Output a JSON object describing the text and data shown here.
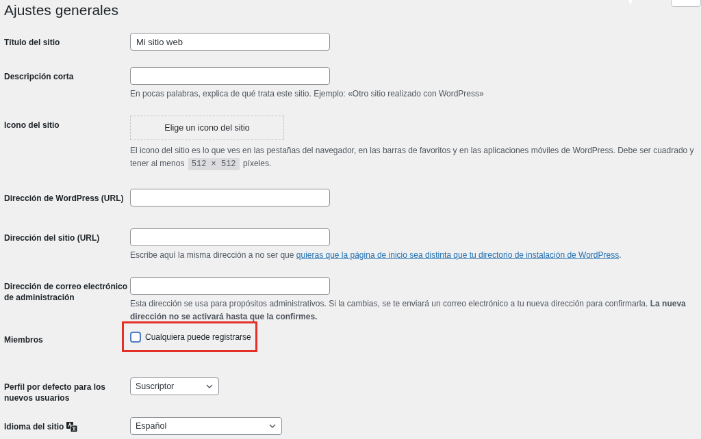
{
  "page_title": "Ajustes generales",
  "rows": [
    {
      "kind": "text",
      "label": "Título del sitio",
      "value": "Mi sitio web"
    },
    {
      "kind": "text",
      "label": "Descripción corta",
      "value": "",
      "description": "En pocas palabras, explica de qué trata este sitio. Ejemplo: «Otro sitio realizado con WordPress»"
    },
    {
      "kind": "icon",
      "label": "Icono del sitio",
      "button": "Elige un icono del sitio",
      "description": "El icono del sitio es lo que ves en las pestañas del navegador, en las barras de favoritos y en las aplicaciones móviles de WordPress. Debe ser cuadrado y tener al menos",
      "code": "512 × 512",
      "description_end": "píxeles."
    },
    {
      "kind": "text",
      "label": "Dirección de WordPress (URL)",
      "value": ""
    },
    {
      "kind": "text",
      "label": "Dirección del sitio (URL)",
      "value": "",
      "description": "Escribe aquí la misma dirección a no ser que",
      "link": "quieras que la página de inicio sea distinta que tu directorio de instalación de WordPress",
      "description_end": "."
    },
    {
      "kind": "text",
      "label": "Dirección de correo electrónico de administración",
      "value": "",
      "description": "Esta dirección se usa para propósitos administrativos. Si la cambias, se te enviará un correo electrónico a tu nueva dirección para confirmarla. **La nueva dirección no se activará hasta que la confirmes.**"
    },
    {
      "kind": "checkbox",
      "label": "Miembros",
      "option": "Cualquiera puede registrarse",
      "checked": false,
      "highlighted": true
    },
    {
      "kind": "select",
      "label": "Perfil por defecto para los nuevos usuarios",
      "value": "Suscriptor"
    },
    {
      "kind": "select",
      "label": "Idioma del sitio",
      "value": "Español",
      "language_icon": true
    }
  ]
}
